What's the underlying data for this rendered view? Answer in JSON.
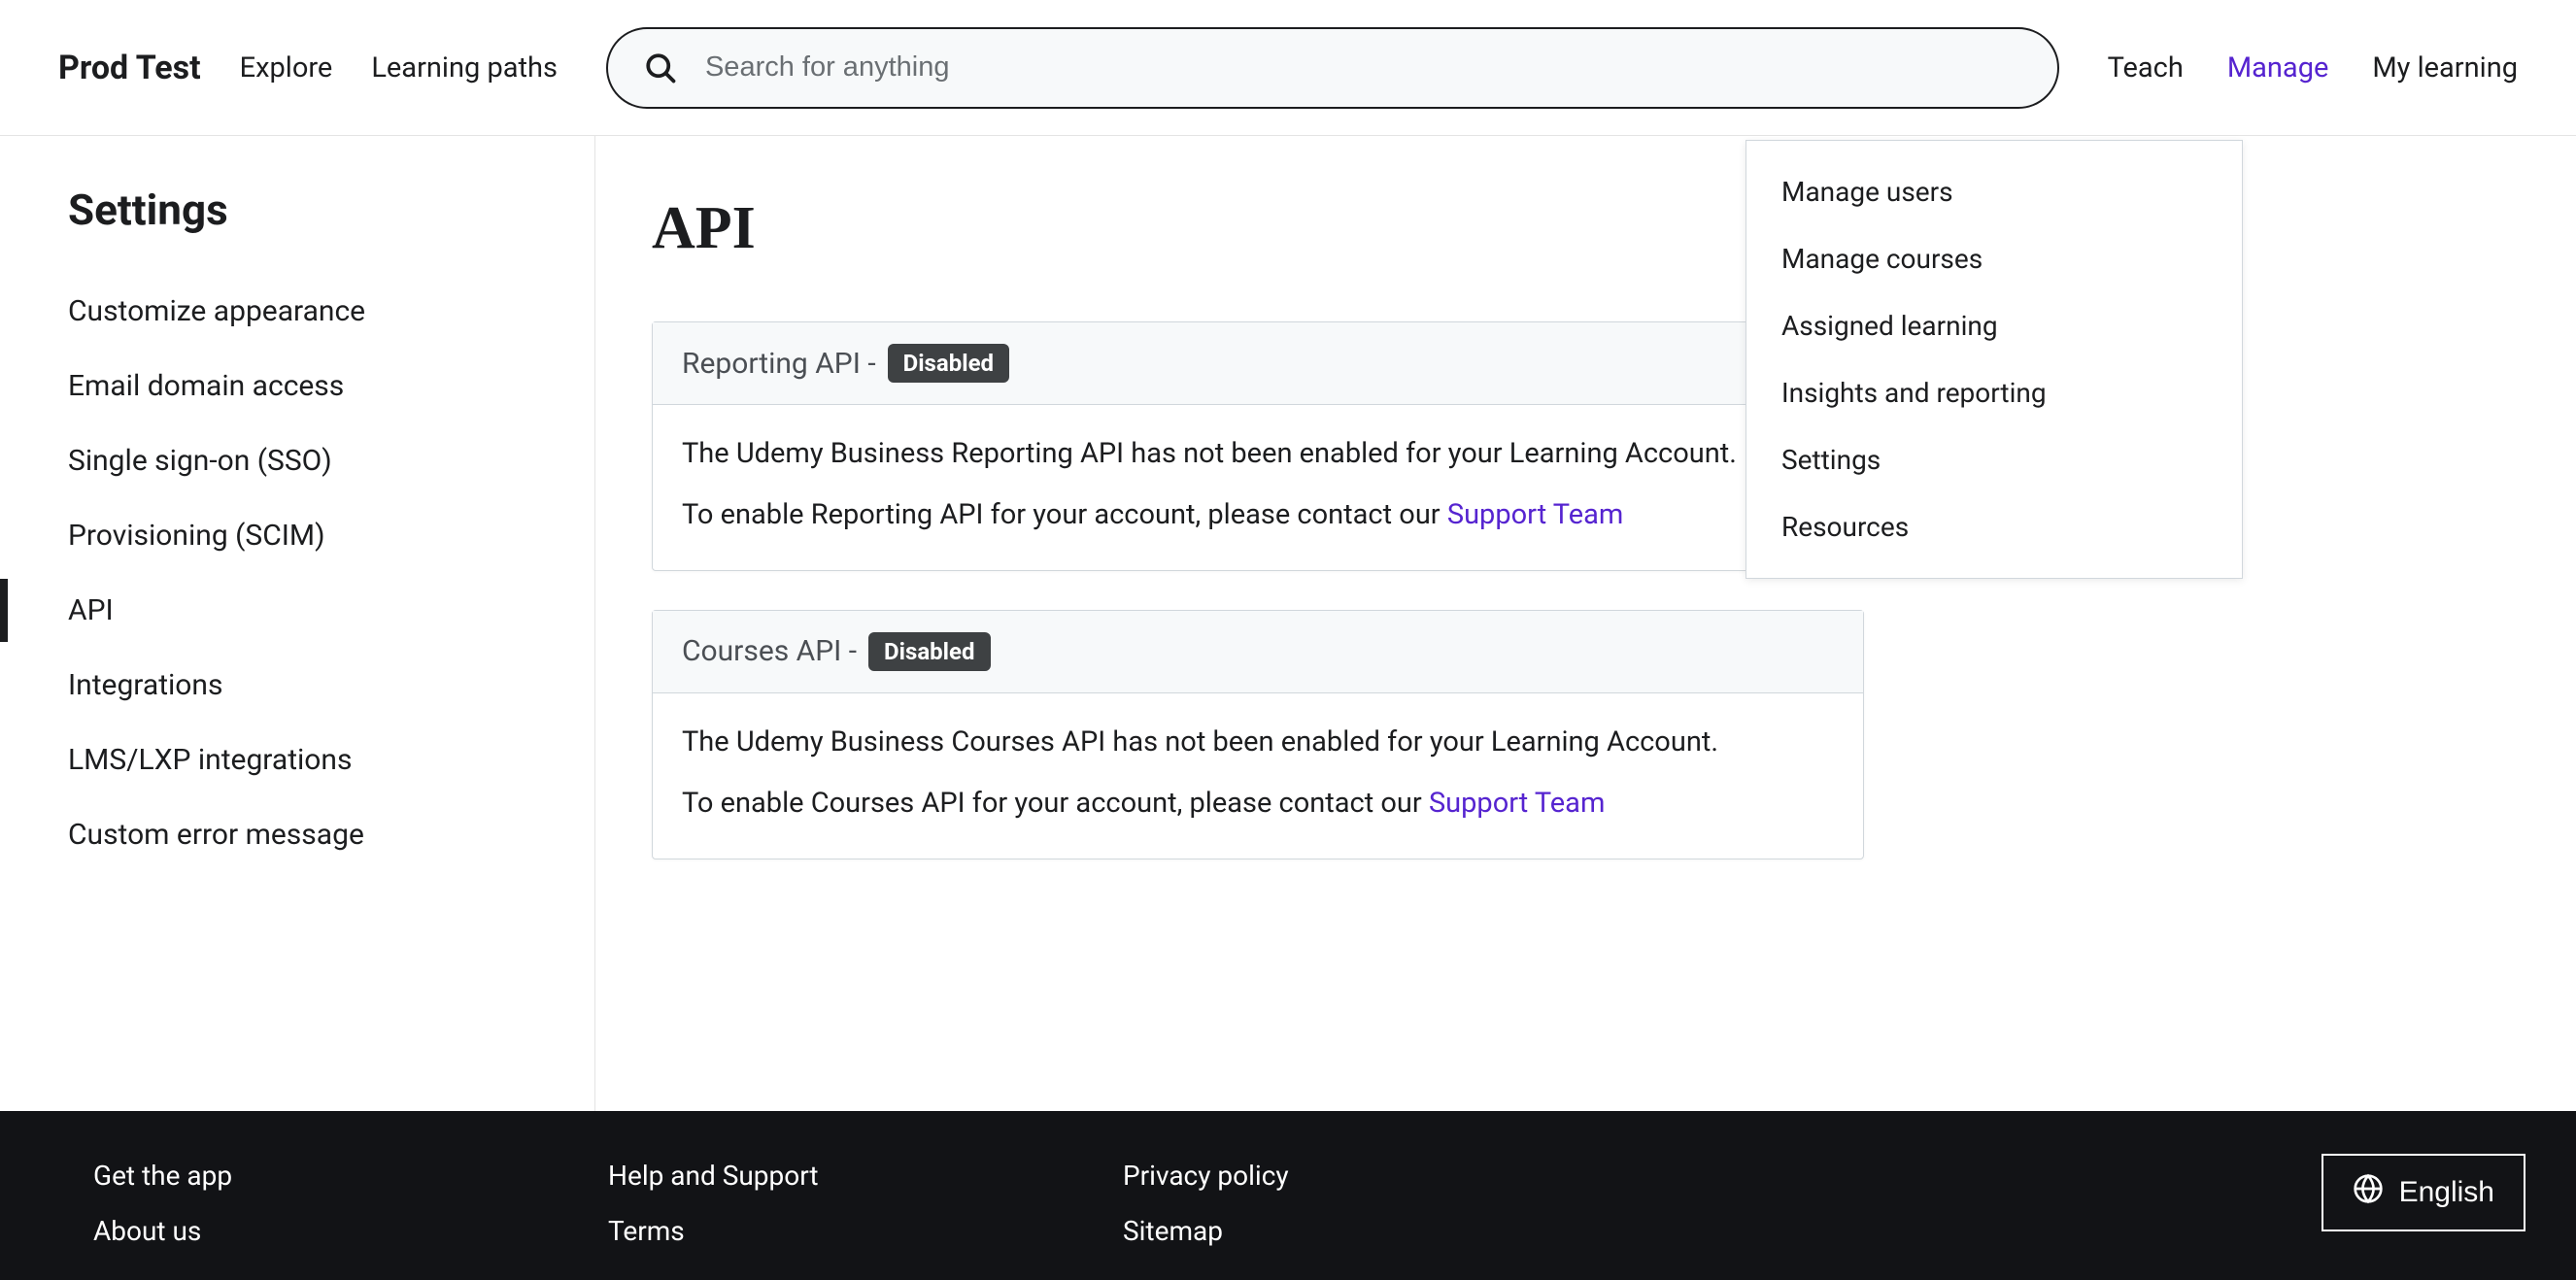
{
  "header": {
    "brand": "Prod Test",
    "nav": {
      "explore": "Explore",
      "learning_paths": "Learning paths"
    },
    "search_placeholder": "Search for anything",
    "right_nav": {
      "teach": "Teach",
      "manage": "Manage",
      "my_learning": "My learning"
    }
  },
  "dropdown": {
    "items": [
      "Manage users",
      "Manage courses",
      "Assigned learning",
      "Insights and reporting",
      "Settings",
      "Resources"
    ]
  },
  "sidebar": {
    "title": "Settings",
    "items": [
      "Customize appearance",
      "Email domain access",
      "Single sign-on (SSO)",
      "Provisioning (SCIM)",
      "API",
      "Integrations",
      "LMS/LXP integrations",
      "Custom error message"
    ],
    "active_index": 4
  },
  "content": {
    "page_title": "API",
    "cards": [
      {
        "title": "Reporting API",
        "sep": " - ",
        "badge": "Disabled",
        "body_line1": "The Udemy Business Reporting API has not been enabled for your Learning Account.",
        "body_line2_prefix": "To enable Reporting API for your account, please contact our ",
        "body_line2_link": "Support Team"
      },
      {
        "title": "Courses API",
        "sep": " - ",
        "badge": "Disabled",
        "body_line1": "The Udemy Business Courses API has not been enabled for your Learning Account.",
        "body_line2_prefix": "To enable Courses API for your account, please contact our ",
        "body_line2_link": "Support Team"
      }
    ]
  },
  "footer": {
    "col1": [
      "Get the app",
      "About us"
    ],
    "col2": [
      "Help and Support",
      "Terms"
    ],
    "col3": [
      "Privacy policy",
      "Sitemap"
    ],
    "language": "English"
  },
  "colors": {
    "accent": "#5624d0",
    "text": "#1c1d1f",
    "footer_bg": "#121316",
    "badge_bg": "#3e4143"
  }
}
